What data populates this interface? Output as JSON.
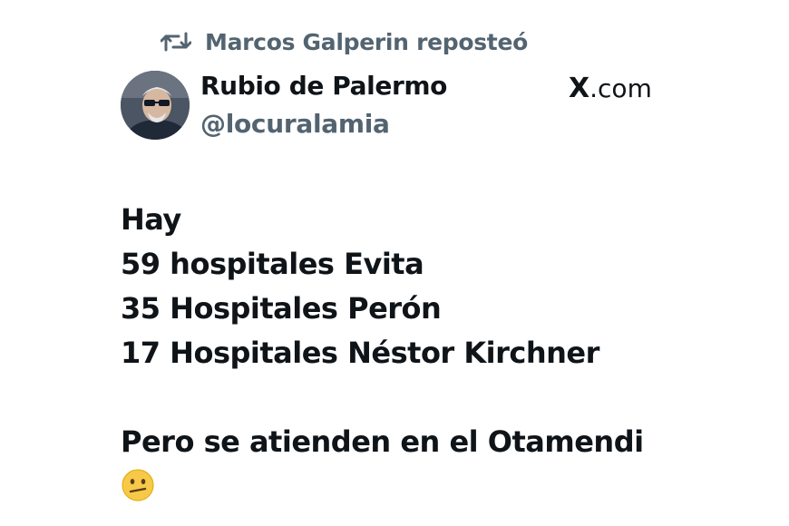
{
  "repost": {
    "icon": "repost-icon",
    "text": "Marcos Galperin reposteó"
  },
  "author": {
    "avatar": "avatar-photo",
    "name": "Rubio de Palermo",
    "handle": "@locuralamia"
  },
  "source": {
    "logo": "X",
    "label": ".com"
  },
  "tweet": {
    "lines": [
      "Hay",
      "59 hospitales Evita",
      "35 Hospitales Perón",
      "17 Hospitales Néstor Kirchner",
      "",
      "Pero se atienden en el Otamendi"
    ],
    "emoji": "confused-face-emoji"
  },
  "colors": {
    "text": "#0f1419",
    "secondary": "#536471",
    "background": "#ffffff"
  }
}
